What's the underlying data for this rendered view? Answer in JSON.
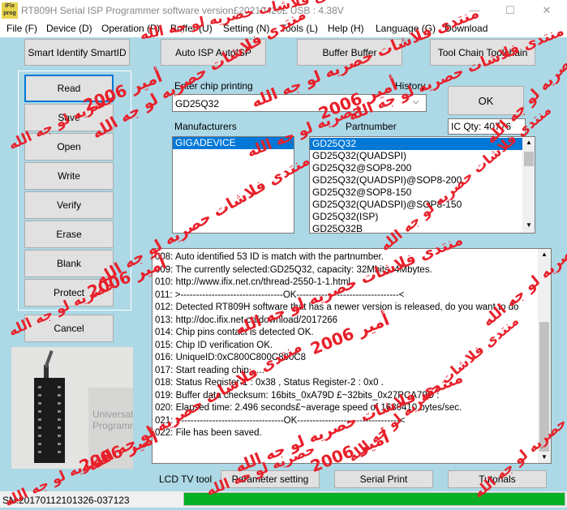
{
  "window": {
    "icon_text": "iFix prog",
    "title": "RT809H Serial ISP Programmer software version£20210420£ USB : 4.38V",
    "minimize": "—",
    "maximize": "☐",
    "close": "✕"
  },
  "menu": [
    "File (F)",
    "Device (D)",
    "Operation (P)",
    "Buffer (U)",
    "Setting (N)",
    "Tools (L)",
    "Help (H)",
    "Language (G)",
    "Download"
  ],
  "toolbar": {
    "smart_identify": "Smart Identify SmartID",
    "auto_isp": "Auto ISP AutoISP",
    "buffer": "Buffer Buffer",
    "tool_chain": "Tool Chain Toolchain"
  },
  "ops": {
    "read": "Read",
    "save": "Save",
    "open": "Open",
    "write": "Write",
    "verify": "Verify",
    "erase": "Erase",
    "blank": "Blank",
    "protect": "Protect",
    "cancel": "Cancel"
  },
  "chip": {
    "enter_label": "Enter chip printing",
    "history_label": "History",
    "value": "GD25Q32",
    "ok": "OK",
    "ic_qty": "IC Qty: 40776"
  },
  "manufacturers": {
    "label": "Manufacturers",
    "items": [
      "GIGADEVICE"
    ]
  },
  "partnumber": {
    "label": "Partnumber",
    "items": [
      "GD25Q32",
      "GD25Q32(QUADSPI)",
      "GD25Q32@SOP8-200",
      "GD25Q32(QUADSPI)@SOP8-200",
      "GD25Q32@SOP8-150",
      "GD25Q32(QUADSPI)@SOP8-150",
      "GD25Q32(ISP)",
      "GD25Q32B"
    ]
  },
  "device_image": {
    "label": "Universal Programmer"
  },
  "log": [
    "008:  Auto identified 53 ID is match with the partnumber.",
    "009:  The currently selected:GD25Q32, capacity: 32Mbits, 4Mbytes.",
    "010:  http://www.ifix.net.cn/thread-2550-1-1.html",
    "011:  >---------------------------------OK---------------------------------<",
    "012:  Detected RT809H software that has a newer version is released, do you want to do",
    "013:  http://doc.ifix.net.cn/download/2017266",
    "014:  Chip pins contact is detected OK.",
    "015:  Chip ID verification OK.",
    "016:  UniqueID:0xC800C800C800C8",
    "017:  Start reading chip......",
    "018:  Status Register-1 : 0x38 , Status Register-2 : 0x0 .",
    "019:  Buffer data checksum: 16bits_0xA79D £~32bits_0x27PCA79D :",
    "020:  Elapsed time: 2.496 seconds£~average speed of 1680410 bytes/sec.",
    "021:  >---------------------------------OK---------------------------------<",
    "022:  File has been saved."
  ],
  "bottom": {
    "lcd_label": "LCD TV tool",
    "parameter": "Parameter setting",
    "serial_print": "Serial Print",
    "tutorials": "Tutorials",
    "sn": "SN:20170112101326-037123",
    "progress": 1.0
  },
  "watermark": {
    "forum": "منتدى فلاشات حصريه لو جه الله",
    "author": "أمير 2006",
    "exclusive": "حصريه لو جه الله",
    "color": "#e8202a"
  },
  "colors": {
    "background": "#add8e6",
    "accent": "#0078d7",
    "progress": "#06b025"
  }
}
